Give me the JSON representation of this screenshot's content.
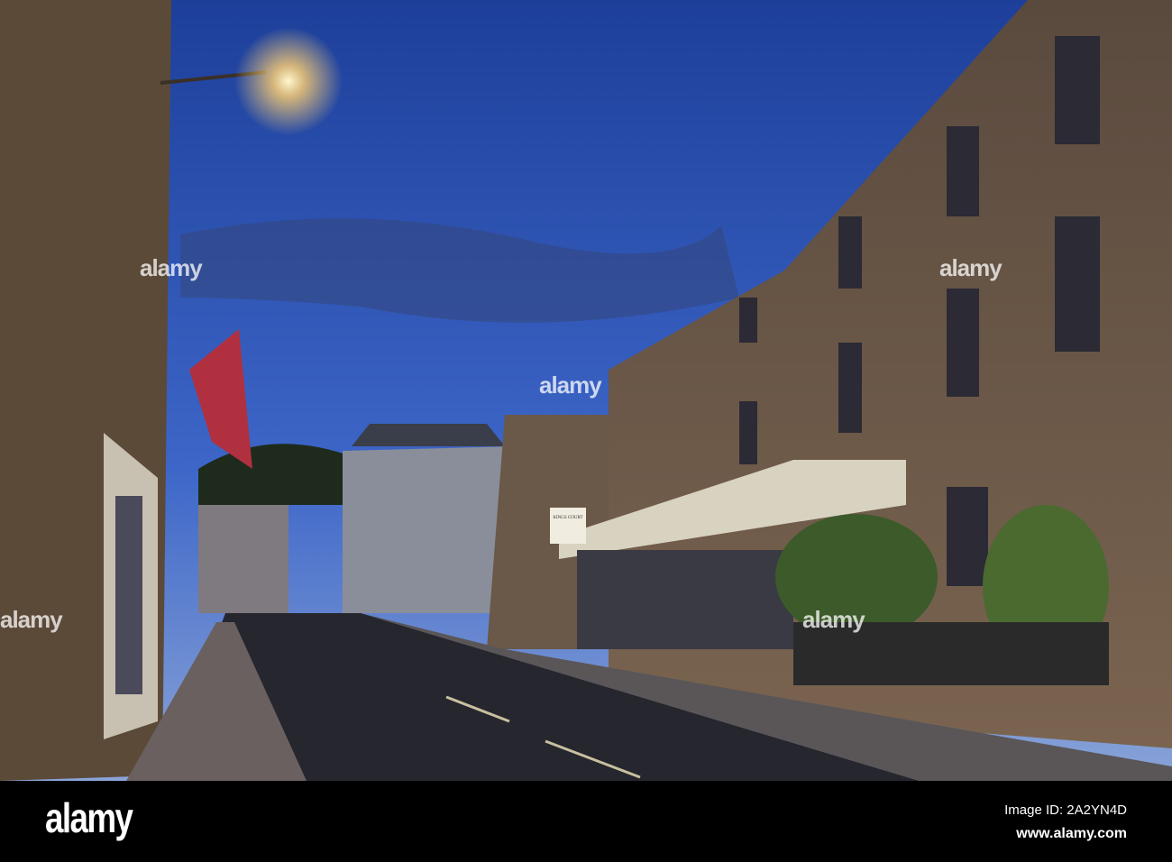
{
  "photo": {
    "description_alt": "Street at dusk"
  },
  "sign": {
    "text": "KINGS COURT"
  },
  "watermark": {
    "text": "alamy"
  },
  "footer": {
    "logo": "alamy",
    "image_id": "Image ID: 2A2YN4D",
    "url": "www.alamy.com"
  }
}
